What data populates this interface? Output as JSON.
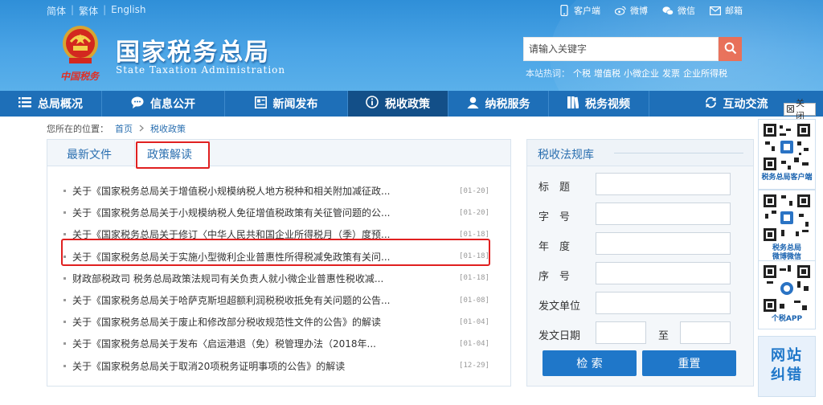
{
  "header": {
    "lang": [
      "简体",
      "繁体",
      "English"
    ],
    "title_cn": "国家税务总局",
    "title_en": "State Taxation Administration",
    "script_brand": "中国税务",
    "links": [
      {
        "label": "客户端",
        "icon": "mobile-icon"
      },
      {
        "label": "微博",
        "icon": "weibo-icon"
      },
      {
        "label": "微信",
        "icon": "wechat-icon"
      },
      {
        "label": "邮箱",
        "icon": "mail-icon"
      }
    ],
    "search_placeholder": "请输入关键字",
    "hot_label": "本站热词：",
    "hot_words": [
      "个税",
      "增值税",
      "小微企业",
      "发票",
      "企业所得税"
    ]
  },
  "nav": [
    {
      "label": "总局概况",
      "icon": "menu-icon"
    },
    {
      "label": "信息公开",
      "icon": "chat-icon"
    },
    {
      "label": "新闻发布",
      "icon": "news-icon"
    },
    {
      "label": "税收政策",
      "icon": "info-icon",
      "active": true
    },
    {
      "label": "纳税服务",
      "icon": "user-icon"
    },
    {
      "label": "税务视频",
      "icon": "book-icon"
    },
    {
      "label": "互动交流",
      "icon": "refresh-icon"
    }
  ],
  "breadcrumb": {
    "prefix": "您所在的位置：",
    "home": "首页",
    "current": "税收政策"
  },
  "tabs": {
    "latest": "最新文件",
    "interpret": "政策解读"
  },
  "list": [
    {
      "title": "关于《国家税务总局关于增值税小规模纳税人地方税种和相关附加减征政...",
      "date": "[01-20]"
    },
    {
      "title": "关于《国家税务总局关于小规模纳税人免征增值税政策有关征管问题的公...",
      "date": "[01-20]"
    },
    {
      "title": "关于《国家税务总局关于修订〈中华人民共和国企业所得税月（季）度预...",
      "date": "[01-18]"
    },
    {
      "title": "关于《国家税务总局关于实施小型微利企业普惠性所得税减免政策有关问...",
      "date": "[01-18]"
    },
    {
      "title": "财政部税政司 税务总局政策法规司有关负责人就小微企业普惠性税收减...",
      "date": "[01-18]"
    },
    {
      "title": "关于《国家税务总局关于哈萨克斯坦超额利润税税收抵免有关问题的公告...",
      "date": "[01-08]"
    },
    {
      "title": "关于《国家税务总局关于废止和修改部分税收规范性文件的公告》的解读",
      "date": "[01-04]"
    },
    {
      "title": "关于《国家税务总局关于发布〈启运港退（免）税管理办法（2018年...",
      "date": "[01-04]"
    },
    {
      "title": "关于《国家税务总局关于取消20项税务证明事项的公告》的解读",
      "date": "[12-29]"
    }
  ],
  "library": {
    "title": "税收法规库",
    "fields": [
      "标　题",
      "字　号",
      "年　度",
      "序　号",
      "发文单位",
      "发文日期"
    ],
    "to": "至",
    "search_btn": "检 索",
    "reset_btn": "重置"
  },
  "sidebar": {
    "close": "关闭",
    "qr": [
      {
        "label": "税务总局客户端"
      },
      {
        "label": "税务总局\n微博微信"
      },
      {
        "label": "个税APP"
      }
    ],
    "report": "网站\n纠错"
  },
  "colors": {
    "header_blue": "#3d9be0",
    "nav_blue": "#1e6fb8",
    "nav_active": "#134f88",
    "highlight_red": "#e02020",
    "button_blue": "#1f77c9"
  }
}
